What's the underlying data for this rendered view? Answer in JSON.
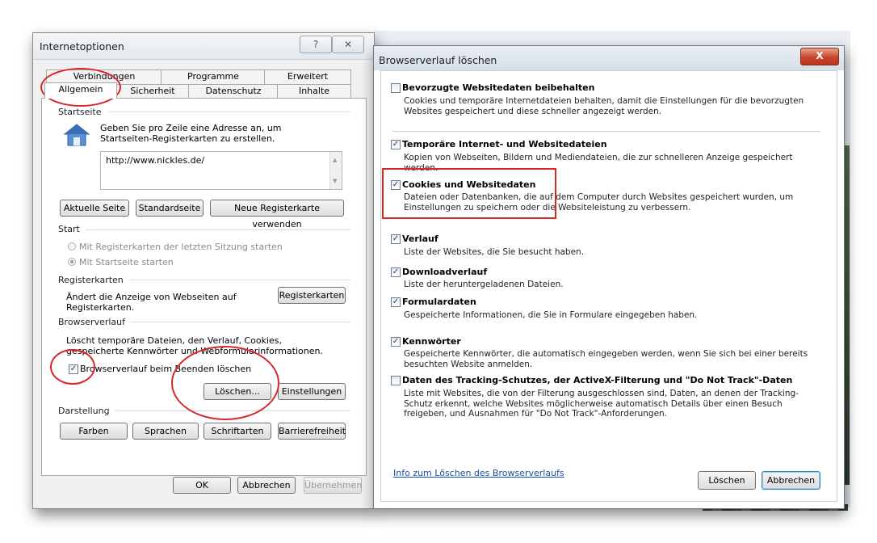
{
  "internet_options": {
    "title": "Internetoptionen",
    "help_glyph": "?",
    "close_glyph": "✕",
    "tabs_back": [
      "Verbindungen",
      "Programme",
      "Erweitert"
    ],
    "tabs_front": [
      "Allgemein",
      "Sicherheit",
      "Datenschutz",
      "Inhalte"
    ],
    "startseite": {
      "group": "Startseite",
      "hint": "Geben Sie pro Zeile eine Adresse an, um Startseiten-Registerkarten zu erstellen.",
      "url": "http://www.nickles.de/",
      "btn_current": "Aktuelle Seite",
      "btn_default": "Standardseite",
      "btn_newtab": "Neue Registerkarte verwenden"
    },
    "start": {
      "group": "Start",
      "opt1": "Mit Registerkarten der letzten Sitzung starten",
      "opt2": "Mit Startseite starten"
    },
    "registerkarten": {
      "group": "Registerkarten",
      "desc": "Ändert die Anzeige von Webseiten auf Registerkarten.",
      "btn": "Registerkarten"
    },
    "browserverlauf": {
      "group": "Browserverlauf",
      "desc": "Löscht temporäre Dateien, den Verlauf, Cookies, gespeicherte Kennwörter und Webformularinformationen.",
      "checkbox": "Browserverlauf beim Beenden löschen",
      "btn_delete": "Löschen...",
      "btn_settings": "Einstellungen"
    },
    "darstellung": {
      "group": "Darstellung",
      "btn_colors": "Farben",
      "btn_languages": "Sprachen",
      "btn_fonts": "Schriftarten",
      "btn_access": "Barrierefreiheit"
    },
    "footer": {
      "ok": "OK",
      "cancel": "Abbrechen",
      "apply": "Übernehmen"
    }
  },
  "delete_history": {
    "title": "Browserverlauf löschen",
    "close_glyph": "X",
    "options": [
      {
        "title": "Bevorzugte Websitedaten beibehalten",
        "desc": "Cookies und temporäre Internetdateien behalten, damit die Einstellungen für die bevorzugten Websites gespeichert und diese schneller angezeigt werden.",
        "checked": false
      },
      {
        "title": "Temporäre Internet- und Websitedateien",
        "desc": "Kopien von Webseiten, Bildern und Mediendateien, die zur schnelleren Anzeige gespeichert werden.",
        "checked": true
      },
      {
        "title": "Cookies und Websitedaten",
        "desc": "Dateien oder Datenbanken, die auf dem Computer durch Websites gespeichert wurden, um Einstellungen zu speichern oder die Websiteleistung zu verbessern.",
        "checked": true
      },
      {
        "title": "Verlauf",
        "desc": "Liste der Websites, die Sie besucht haben.",
        "checked": true
      },
      {
        "title": "Downloadverlauf",
        "desc": "Liste der heruntergeladenen Dateien.",
        "checked": true
      },
      {
        "title": "Formulardaten",
        "desc": "Gespeicherte Informationen, die Sie in Formulare eingegeben haben.",
        "checked": true
      },
      {
        "title": "Kennwörter",
        "desc": "Gespeicherte Kennwörter, die automatisch eingegeben werden, wenn Sie sich bei einer bereits besuchten Website anmelden.",
        "checked": true
      },
      {
        "title": "Daten des Tracking-Schutzes, der ActiveX-Filterung und \"Do Not Track\"-Daten",
        "desc": "Liste mit Websites, die von der Filterung ausgeschlossen sind, Daten, an denen der Tracking-Schutz erkennt, welche Websites möglicherweise automatisch Details über einen Besuch freigeben, und Ausnahmen für \"Do Not Track\"-Anforderungen.",
        "checked": false
      }
    ],
    "info_link": "Info zum Löschen des Browserverlaufs",
    "btn_delete": "Löschen",
    "btn_cancel": "Abbrechen"
  },
  "check_glyph": "✓"
}
